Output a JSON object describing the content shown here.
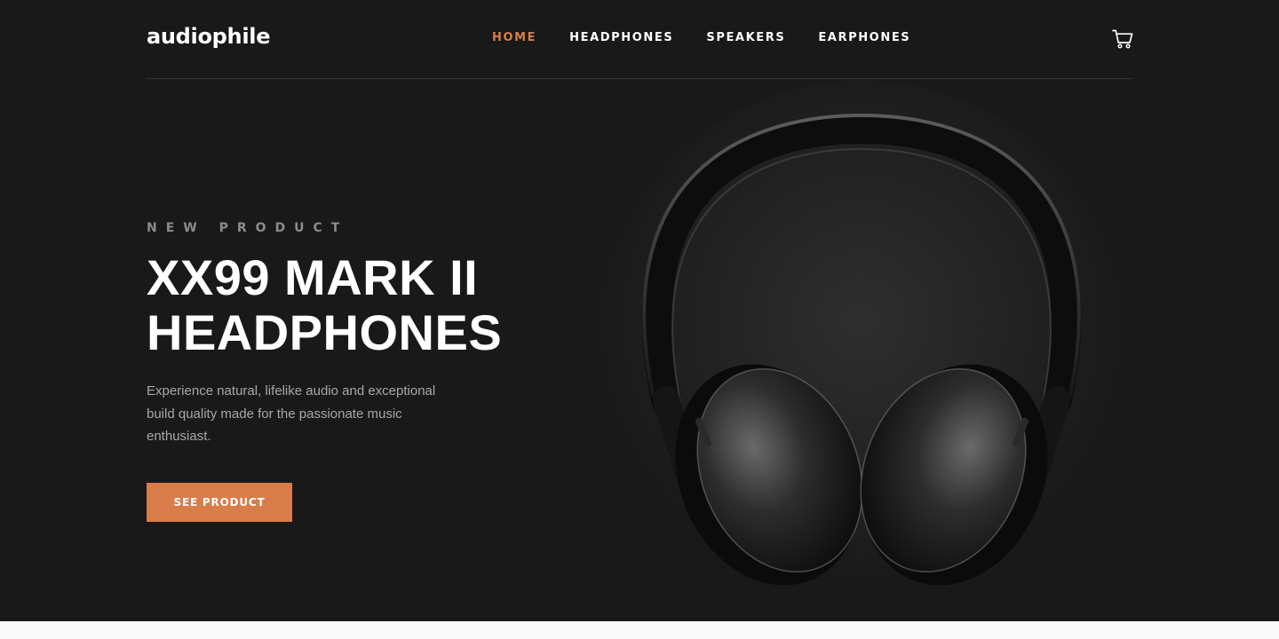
{
  "header": {
    "logo": "audiophile",
    "nav": [
      {
        "label": "HOME",
        "active": true
      },
      {
        "label": "HEADPHONES",
        "active": false
      },
      {
        "label": "SPEAKERS",
        "active": false
      },
      {
        "label": "EARPHONES",
        "active": false
      }
    ],
    "cart_icon": "cart-icon"
  },
  "hero": {
    "overline": "NEW PRODUCT",
    "title_line1": "XX99 MARK II",
    "title_line2": "HEADPHONES",
    "description": "Experience natural, lifelike audio and exceptional build quality made for the passionate music enthusiast.",
    "cta_label": "SEE PRODUCT",
    "image": "headphones-image"
  },
  "colors": {
    "accent": "#d87d4a",
    "hero_bg": "#191919",
    "text": "#ffffff",
    "muted": "#8c8c8c"
  }
}
